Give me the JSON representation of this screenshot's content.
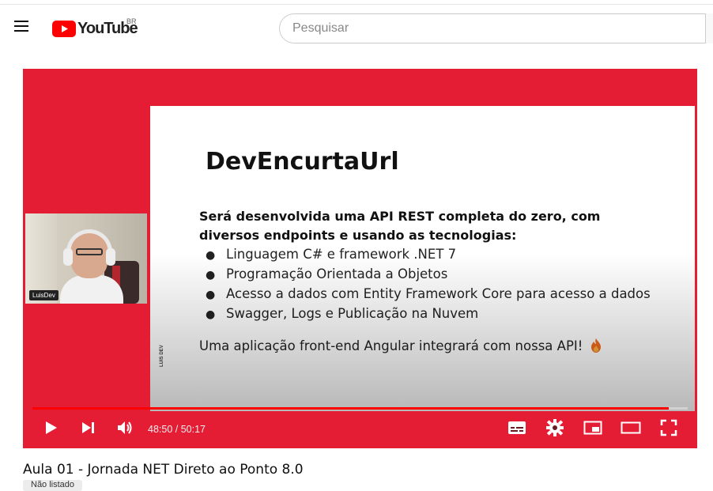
{
  "header": {
    "logo_text": "YouTube",
    "country_code": "BR",
    "search_placeholder": "Pesquisar"
  },
  "slide": {
    "title": "DevEncurtaUrl",
    "intro": "Será desenvolvida uma API REST completa do zero, com diversos endpoints e usando as tecnologias:",
    "bullets": [
      "Linguagem C# e framework .NET 7",
      "Programação Orientada a Objetos",
      "Acesso a dados com Entity Framework Core para acesso a dados",
      "Swagger, Logs e Publicação na Nuvem"
    ],
    "footer": "Uma aplicação front-end Angular integrará com nossa API!",
    "mark": "LUIS DEV"
  },
  "webcam": {
    "label": "LuisDev"
  },
  "player": {
    "time_current": "48:50",
    "time_total": "50:17",
    "time_display": "48:50 / 50:17",
    "progress_fraction": 0.971,
    "accent_color": "#e41d35"
  },
  "video": {
    "title": "Aula 01 - Jornada NET Direto ao Ponto 8.0",
    "chip": "Não listado"
  },
  "icons": [
    "menu-icon",
    "youtube-logo-icon",
    "play-icon",
    "next-icon",
    "volume-icon",
    "subtitles-icon",
    "settings-icon",
    "miniplayer-icon",
    "theater-icon",
    "fullscreen-icon",
    "fire-icon"
  ]
}
